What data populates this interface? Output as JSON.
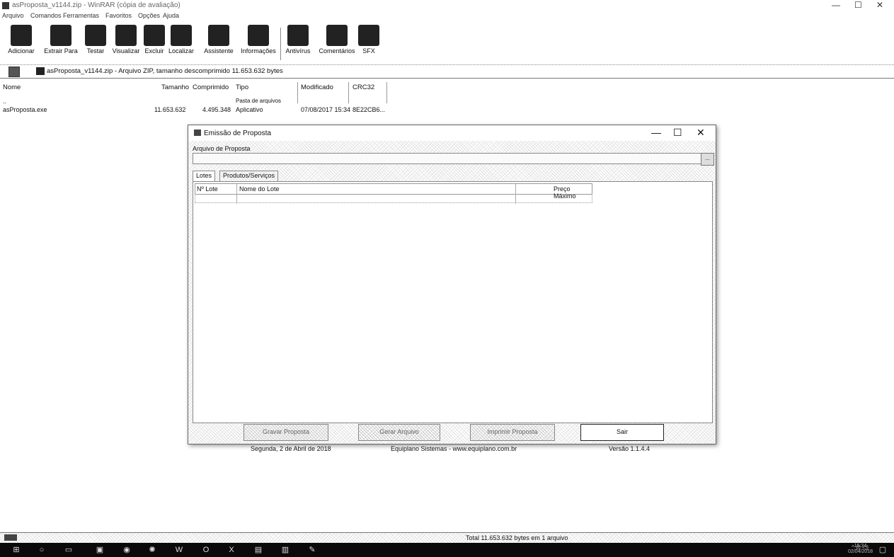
{
  "window": {
    "title": "asProposta_v1144.zip - WinRAR (cópia de avaliação)",
    "minimize": "—",
    "maximize": "☐",
    "close": "✕"
  },
  "menu": [
    "Arquivo",
    "Comandos",
    "Ferramentas",
    "Favoritos",
    "Opções",
    "Ajuda"
  ],
  "toolbar": [
    {
      "label": "Adicionar",
      "icon": "add-archive-icon"
    },
    {
      "label": "Extrair Para",
      "icon": "extract-icon"
    },
    {
      "label": "Testar",
      "icon": "test-icon"
    },
    {
      "label": "Visualizar",
      "icon": "view-icon"
    },
    {
      "label": "Excluir",
      "icon": "delete-icon"
    },
    {
      "label": "Localizar",
      "icon": "find-icon"
    },
    {
      "label": "Assistente",
      "icon": "wizard-icon"
    },
    {
      "label": "Informações",
      "icon": "info-icon"
    },
    {
      "label": "Antivírus",
      "icon": "antivirus-icon"
    },
    {
      "label": "Comentários",
      "icon": "comment-icon"
    },
    {
      "label": "SFX",
      "icon": "sfx-icon"
    }
  ],
  "address": {
    "path": "asProposta_v1144.zip - Arquivo ZIP, tamanho descomprimido 11.653.632 bytes"
  },
  "columns": {
    "name": "Nome",
    "size": "Tamanho",
    "packed": "Comprimido",
    "type": "Tipo",
    "modified": "Modificado",
    "crc": "CRC32"
  },
  "files": [
    {
      "name": "..",
      "type": "Pasta de arquivos"
    },
    {
      "name": "asProposta.exe",
      "size": "11.653.632",
      "packed": "4.495.348",
      "type": "Aplicativo",
      "modified": "07/08/2017 15:34",
      "crc": "8E22CB6..."
    }
  ],
  "dialog": {
    "title": "Emissão de Proposta",
    "minimize": "—",
    "maximize": "☐",
    "close": "✕",
    "arquivo_label": "Arquivo de Proposta",
    "arquivo_value": "",
    "browse": "...",
    "tabs": [
      "Lotes",
      "Produtos/Serviços"
    ],
    "grid_headers": {
      "num": "Nº Lote",
      "name": "Nome do Lote",
      "price": "Preço Máximo"
    },
    "buttons": {
      "b1": "Gravar Proposta",
      "b2": "Gerar Arquivo",
      "b3": "Imprimir Proposta",
      "sair": "Sair"
    },
    "status_date": "Segunda, 2 de Abril de 2018",
    "status_company": "Equiplano Sistemas - www.equiplano.com.br",
    "status_version": "Versão 1.1.4.4"
  },
  "statusbar": {
    "summary": "Total 11.653.632 bytes em 1 arquivo"
  },
  "taskbar": {
    "tray": "^ ⊡ ◁)",
    "clock_time": "15:34",
    "clock_date": "02/04/2018"
  }
}
